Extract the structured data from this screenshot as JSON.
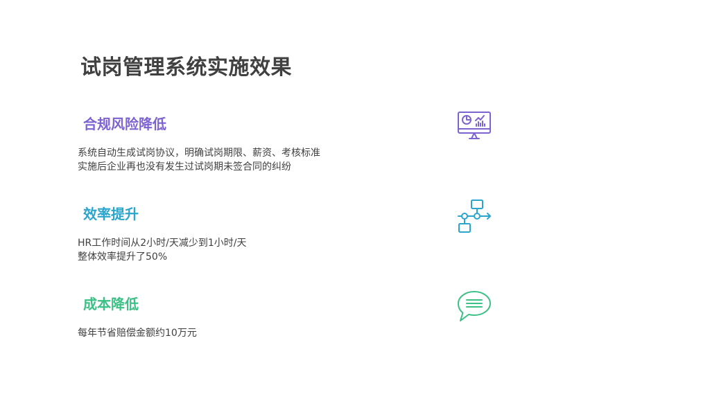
{
  "page": {
    "title": "试岗管理系统实施效果"
  },
  "sections": [
    {
      "title": "合规风险降低",
      "color": "#7d63d2",
      "icon": "dashboard-monitor-icon",
      "lines": [
        "系统自动生成试岗协议，明确试岗期限、薪资、考核标准",
        "实施后企业再也没有发生过试岗期未签合同的纠纷"
      ]
    },
    {
      "title": "效率提升",
      "color": "#2aa5cc",
      "icon": "workflow-icon",
      "lines": [
        "HR工作时间从2小时/天减少到1小时/天",
        "整体效率提升了50%"
      ]
    },
    {
      "title": "成本降低",
      "color": "#3cc085",
      "icon": "chat-bubble-icon",
      "lines": [
        "每年节省赔偿金额约10万元"
      ]
    }
  ]
}
